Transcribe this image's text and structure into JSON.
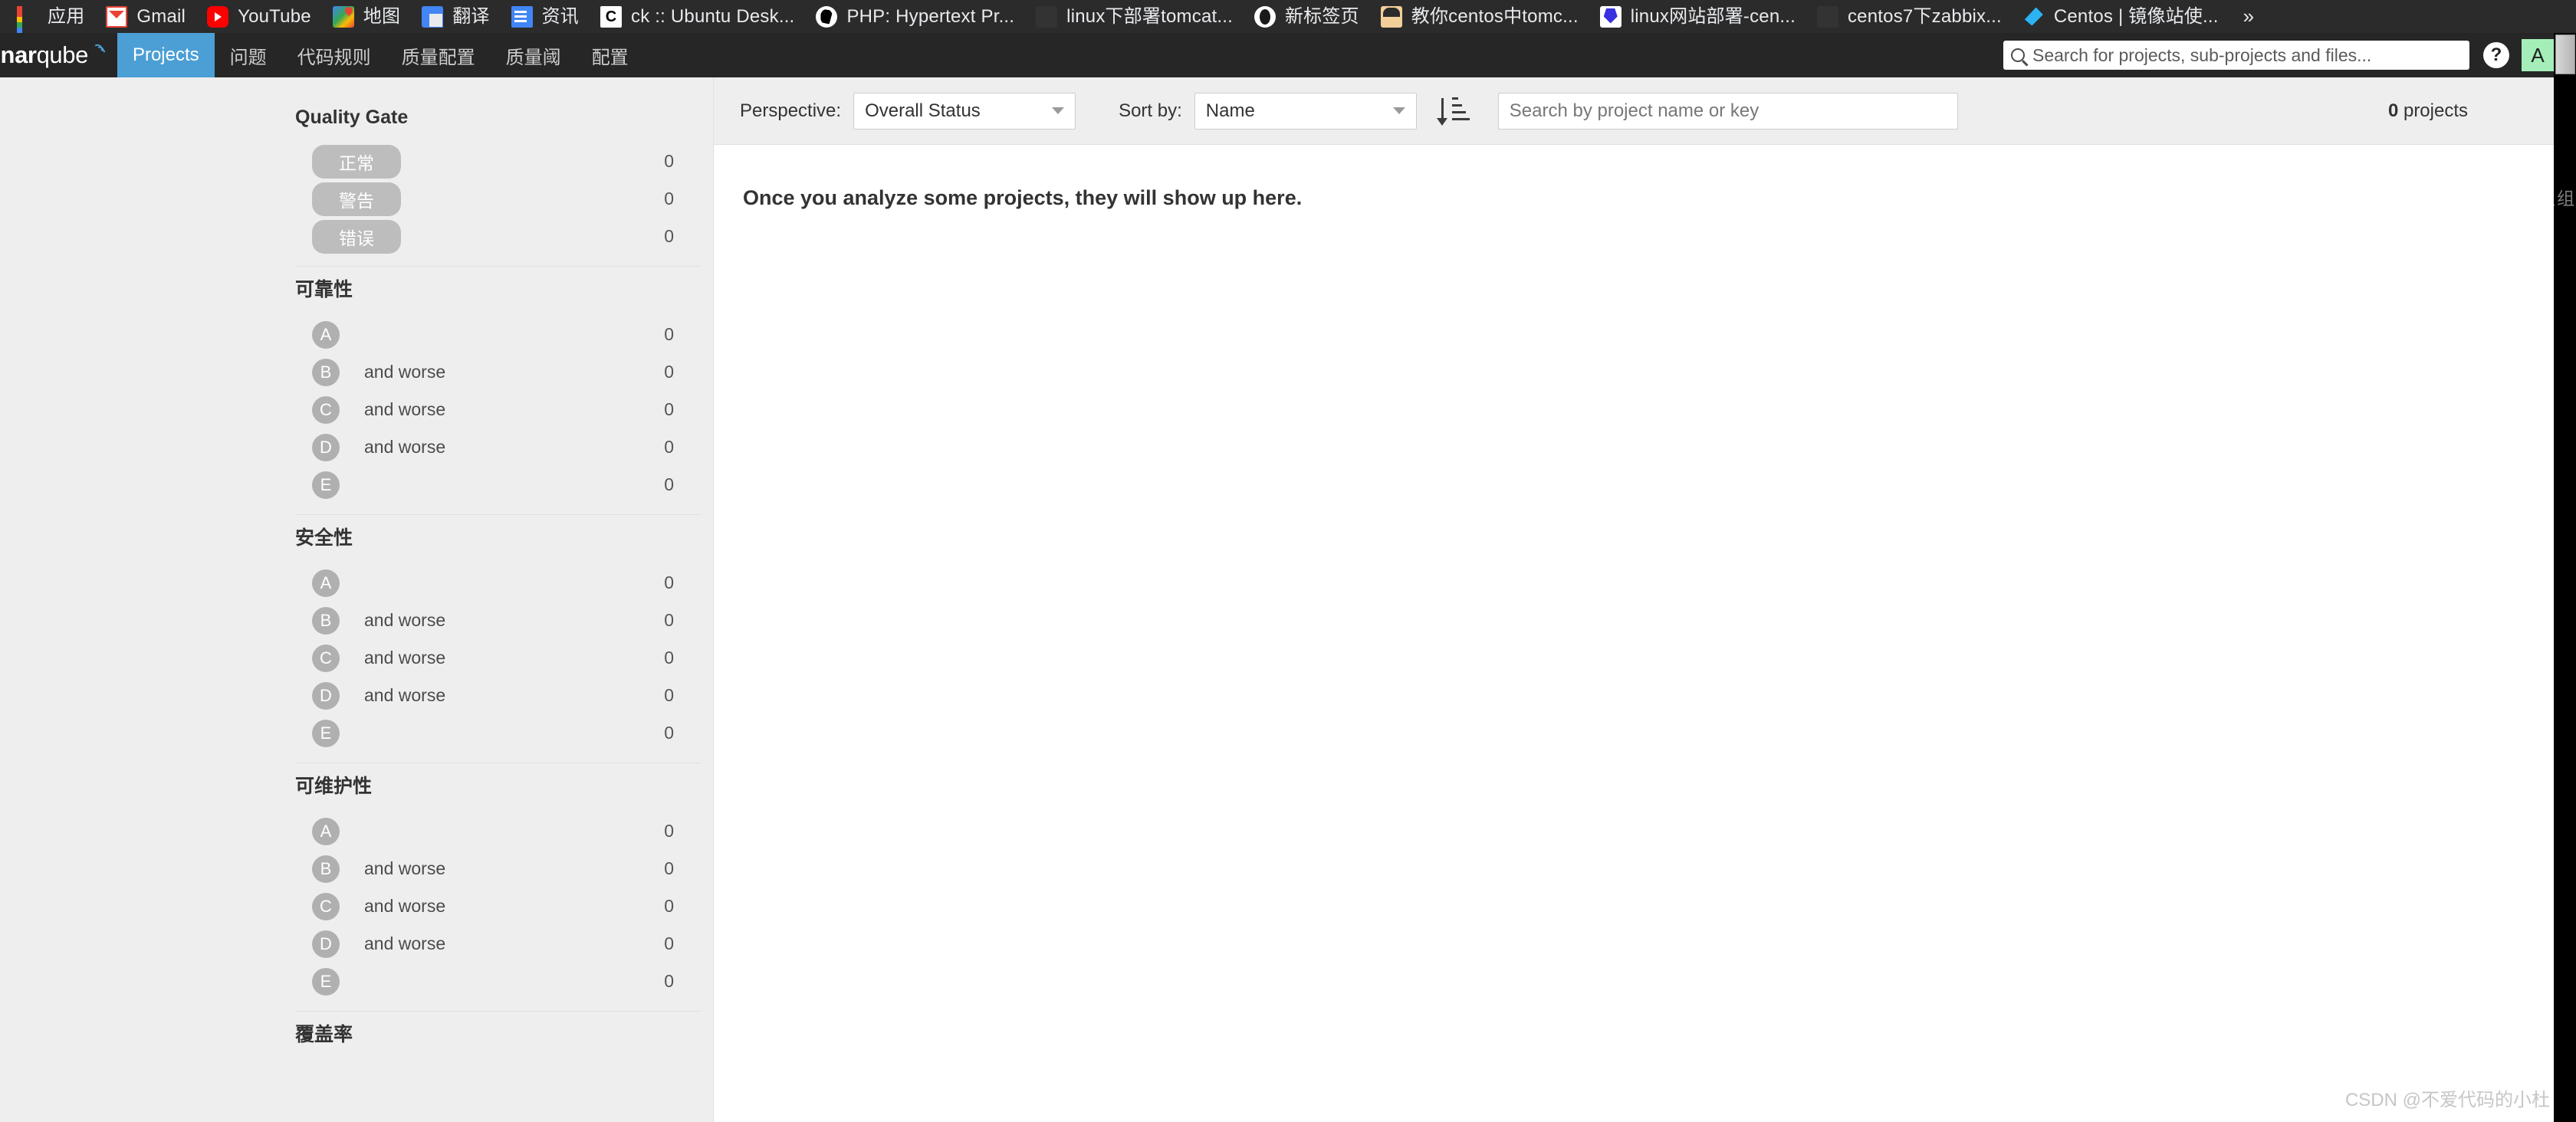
{
  "browser": {
    "bookmarks": [
      {
        "label": "应用",
        "icon": "apps-grid-icon"
      },
      {
        "label": "Gmail",
        "icon": "gmail-icon"
      },
      {
        "label": "YouTube",
        "icon": "youtube-icon"
      },
      {
        "label": "地图",
        "icon": "google-maps-icon"
      },
      {
        "label": "翻译",
        "icon": "google-translate-icon"
      },
      {
        "label": "资讯",
        "icon": "google-news-icon"
      },
      {
        "label": "ck :: Ubuntu Desk...",
        "icon": "ck-icon"
      },
      {
        "label": "PHP: Hypertext Pr...",
        "icon": "php-icon"
      },
      {
        "label": "linux下部署tomcat...",
        "icon": "generic-page-icon"
      },
      {
        "label": "新标签页",
        "icon": "new-tab-icon"
      },
      {
        "label": "教你centos中tomc...",
        "icon": "anime-avatar-icon"
      },
      {
        "label": "linux网站部署-cen...",
        "icon": "baidu-icon"
      },
      {
        "label": "centos7下zabbix...",
        "icon": "generic-page-icon"
      },
      {
        "label": "Centos | 镜像站使...",
        "icon": "centos-mirror-icon"
      }
    ],
    "overflow_label": "»"
  },
  "sonarqube_nav": {
    "logo_text_bold": "onar",
    "logo_text_light": "qube",
    "items": [
      {
        "label": "Projects",
        "active": true
      },
      {
        "label": "问题",
        "active": false
      },
      {
        "label": "代码规则",
        "active": false
      },
      {
        "label": "质量配置",
        "active": false
      },
      {
        "label": "质量阈",
        "active": false
      },
      {
        "label": "配置",
        "active": false
      }
    ],
    "search_placeholder": "Search for projects, sub-projects and files...",
    "help_glyph": "?",
    "avatar_initial": "A",
    "avatar_color": "#a5eeb9",
    "active_color": "#4b9fd5"
  },
  "sidebar": {
    "facets": [
      {
        "title": "Quality Gate",
        "style": "pill",
        "rows": [
          {
            "label": "正常",
            "count": "0"
          },
          {
            "label": "警告",
            "count": "0"
          },
          {
            "label": "错误",
            "count": "0"
          }
        ]
      },
      {
        "title": "可靠性",
        "style": "rating",
        "rows": [
          {
            "rating": "A",
            "label": "",
            "count": "0"
          },
          {
            "rating": "B",
            "label": "and worse",
            "count": "0"
          },
          {
            "rating": "C",
            "label": "and worse",
            "count": "0"
          },
          {
            "rating": "D",
            "label": "and worse",
            "count": "0"
          },
          {
            "rating": "E",
            "label": "",
            "count": "0"
          }
        ]
      },
      {
        "title": "安全性",
        "style": "rating",
        "rows": [
          {
            "rating": "A",
            "label": "",
            "count": "0"
          },
          {
            "rating": "B",
            "label": "and worse",
            "count": "0"
          },
          {
            "rating": "C",
            "label": "and worse",
            "count": "0"
          },
          {
            "rating": "D",
            "label": "and worse",
            "count": "0"
          },
          {
            "rating": "E",
            "label": "",
            "count": "0"
          }
        ]
      },
      {
        "title": "可维护性",
        "style": "rating",
        "rows": [
          {
            "rating": "A",
            "label": "",
            "count": "0"
          },
          {
            "rating": "B",
            "label": "and worse",
            "count": "0"
          },
          {
            "rating": "C",
            "label": "and worse",
            "count": "0"
          },
          {
            "rating": "D",
            "label": "and worse",
            "count": "0"
          },
          {
            "rating": "E",
            "label": "",
            "count": "0"
          }
        ]
      },
      {
        "title": "覆盖率",
        "style": "rating",
        "rows": []
      }
    ]
  },
  "toolbar": {
    "perspective_label": "Perspective:",
    "perspective_value": "Overall Status",
    "sort_label": "Sort by:",
    "sort_value": "Name",
    "sort_direction_icon": "sort-descending-icon",
    "search_placeholder": "Search by project name or key",
    "project_count_number": "0",
    "project_count_suffix": " projects"
  },
  "main": {
    "empty_message": "Once you analyze some projects, they will show up here."
  },
  "artifacts": {
    "edge_ghost_text": "组组",
    "watermark": "CSDN @不爱代码的小杜"
  }
}
